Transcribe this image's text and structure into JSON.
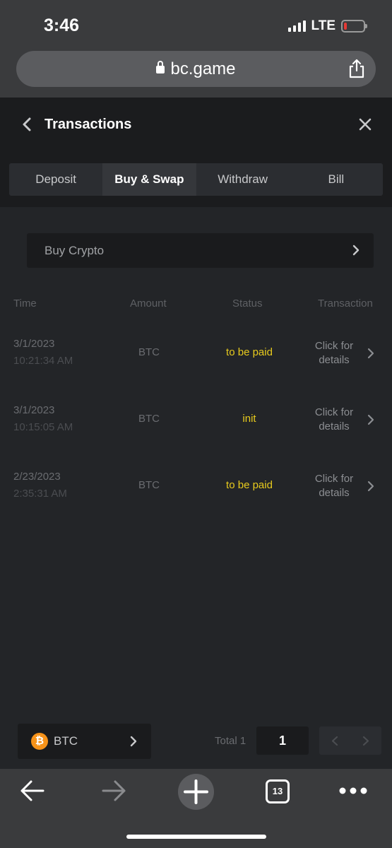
{
  "status_bar": {
    "time": "3:46",
    "network": "LTE"
  },
  "browser": {
    "url": "bc.game",
    "tabs_count": "13"
  },
  "header": {
    "title": "Transactions"
  },
  "tabs": [
    {
      "label": "Deposit",
      "active": false
    },
    {
      "label": "Buy & Swap",
      "active": true
    },
    {
      "label": "Withdraw",
      "active": false
    },
    {
      "label": "Bill",
      "active": false
    }
  ],
  "buy_crypto": {
    "label": "Buy Crypto"
  },
  "table": {
    "headers": [
      "Time",
      "Amount",
      "Status",
      "Transaction"
    ],
    "rows": [
      {
        "date": "3/1/2023",
        "time": "10:21:34 AM",
        "amount": "BTC",
        "status": "to be paid",
        "details_line1": "Click for",
        "details_line2": "details"
      },
      {
        "date": "3/1/2023",
        "time": "10:15:05 AM",
        "amount": "BTC",
        "status": "init",
        "details_line1": "Click for",
        "details_line2": "details"
      },
      {
        "date": "2/23/2023",
        "time": "2:35:31 AM",
        "amount": "BTC",
        "status": "to be paid",
        "details_line1": "Click for",
        "details_line2": "details"
      }
    ]
  },
  "pagination": {
    "coin": "BTC",
    "total_label": "Total 1",
    "page": "1"
  },
  "colors": {
    "status_yellow": "#e8cb1d",
    "btc_orange": "#f7931a",
    "battery_low": "#e53935"
  }
}
